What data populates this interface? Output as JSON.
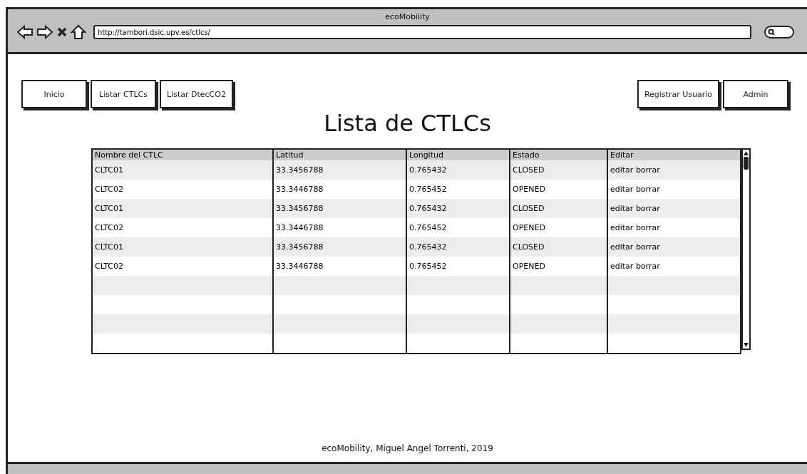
{
  "window": {
    "title": "ecoMobility"
  },
  "address_bar": {
    "value": "http://tambori.dsic.upv.es/ctlcs/"
  },
  "nav_left": [
    "Inicio",
    "Listar CTLCs",
    "Listar DtecCO2"
  ],
  "nav_right": [
    "Registrar Usuario",
    "Admin"
  ],
  "heading": "Lista de CTLCs",
  "table": {
    "columns": [
      "Nombre del CTLC",
      "Latitud",
      "Longitud",
      "Estado",
      "Editar"
    ],
    "rows": [
      [
        "CLTC01",
        "33.3456788",
        "0.765432",
        "CLOSED",
        "editar borrar"
      ],
      [
        "CLTC02",
        "33.3446788",
        "0.765452",
        "OPENED",
        "editar borrar"
      ],
      [
        "CLTC01",
        "33.3456788",
        "0.765432",
        "CLOSED",
        "editar borrar"
      ],
      [
        "CLTC02",
        "33.3446788",
        "0.765452",
        "OPENED",
        "editar borrar"
      ],
      [
        "CLTC01",
        "33.3456788",
        "0.765432",
        "CLOSED",
        "editar borrar"
      ],
      [
        "CLTC02",
        "33.3446788",
        "0.765452",
        "OPENED",
        "editar borrar"
      ]
    ]
  },
  "footer": "ecoMobility, Miguel Angel Torrenti, 2019"
}
